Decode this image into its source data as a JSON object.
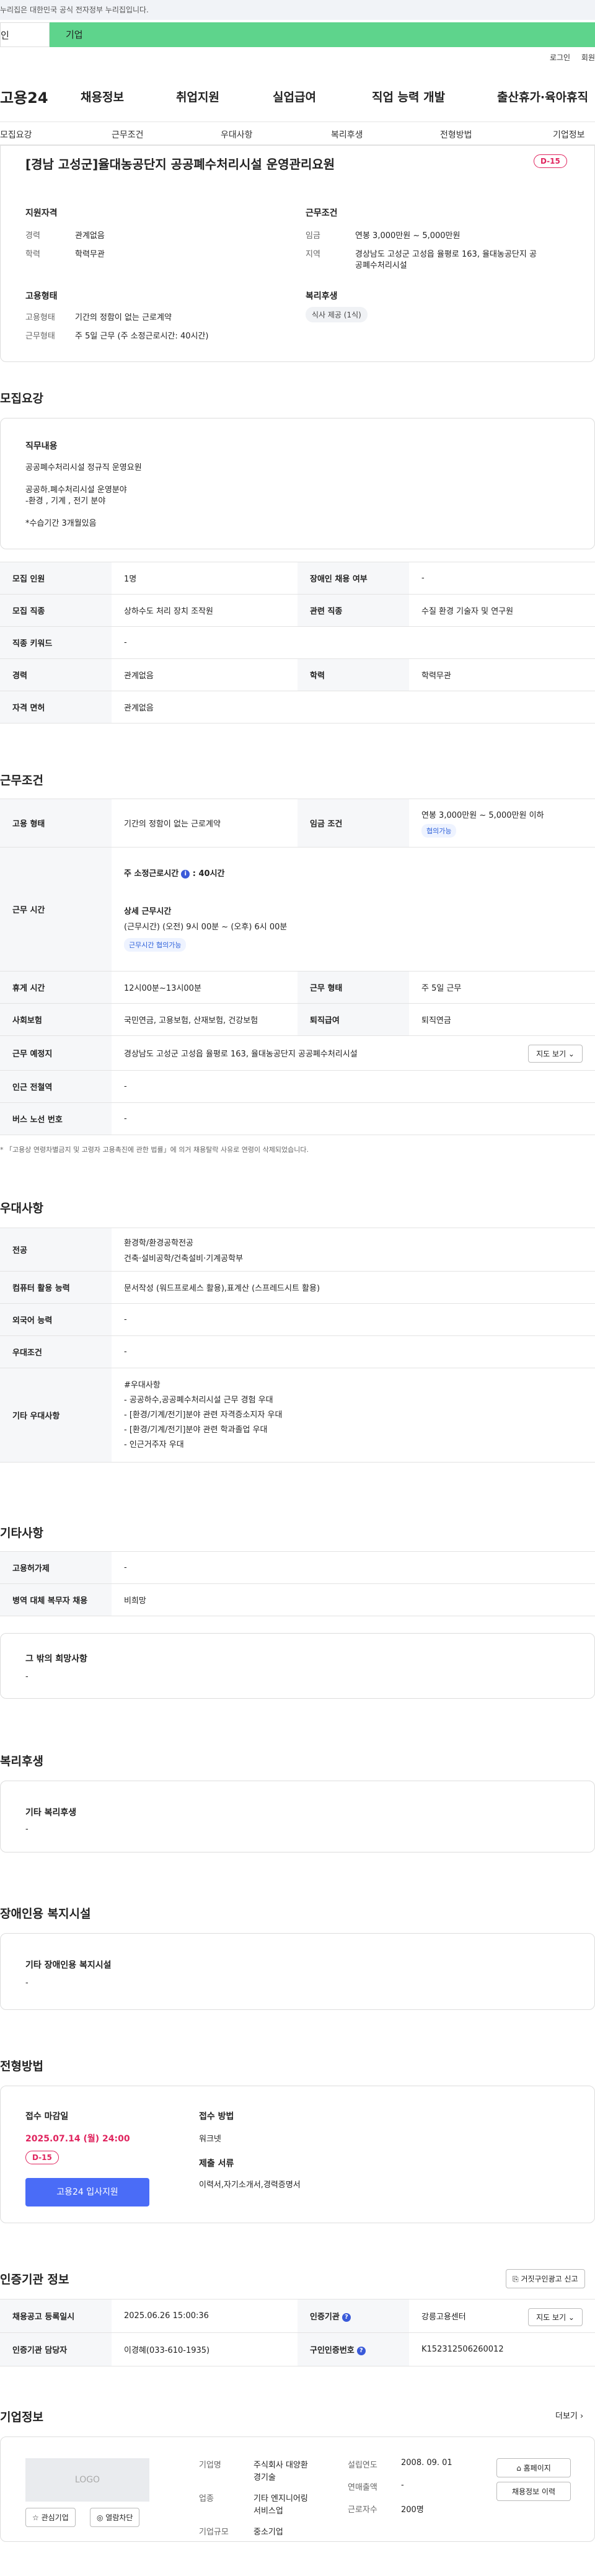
{
  "gov_banner": "누리집은 대한민국 공식 전자정부 누리집입니다.",
  "user_tabs": {
    "individual": "인",
    "company": "기업"
  },
  "util": {
    "login": "로그인",
    "join": "회원"
  },
  "gnb": {
    "logo": "고용24",
    "items": [
      "채용정보",
      "취업지원",
      "실업급여",
      "직업 능력 개발",
      "출산휴가·육아휴직"
    ]
  },
  "snb": [
    "모집요강",
    "근무조건",
    "우대사항",
    "복리후생",
    "전형방법",
    "기업정보"
  ],
  "job": {
    "title": "[경남 고성군]율대농공단지 공공폐수처리시설 운영관리요원",
    "dday": "D-15",
    "qualification": {
      "heading": "지원자격",
      "career_label": "경력",
      "career": "관계없음",
      "edu_label": "학력",
      "edu": "학력무관"
    },
    "condition": {
      "heading": "근무조건",
      "wage_label": "임금",
      "wage": "연봉 3,000만원 ~ 5,000만원",
      "region_label": "지역",
      "region_1": "경상남도 고성군 고성읍 율평로 163, 율대농공단지 공",
      "region_2": "공폐수처리시설"
    },
    "employment": {
      "heading": "고용형태",
      "type_label": "고용형태",
      "type": "기간의 정함이 없는 근로계약",
      "hours_label": "근무형태",
      "hours": "주 5일 근무 (주 소정근로시간: 40시간)"
    },
    "welfare": {
      "heading": "복리후생",
      "pill": "식사 제공 (1식)"
    }
  },
  "recruit": {
    "title": "모집요강",
    "duty_heading": "직무내용",
    "duty_lines": [
      "공공폐수처리시설 정규직 운영요원",
      "",
      "공공하.폐수처리시설 운영분야",
      "-환경 , 기계 , 전기 분야",
      "",
      "*수습기간 3개월있음"
    ],
    "table": {
      "headcount_label": "모집 인원",
      "headcount": "1명",
      "disabled_label": "장애인 채용 여부",
      "disabled": "-",
      "job_label": "모집 직종",
      "job": "상하수도 처리 장치 조작원",
      "related_label": "관련 직종",
      "related": "수질 환경 기술자 및 연구원",
      "keyword_label": "직종 키워드",
      "keyword": "-",
      "career_label": "경력",
      "career": "관계없음",
      "edu_label": "학력",
      "edu": "학력무관",
      "license_label": "자격 면허",
      "license": "관계없음"
    }
  },
  "work": {
    "title": "근무조건",
    "type_label": "고용 형태",
    "type": "기간의 정함이 없는 근로계약",
    "wage_label": "임금 조건",
    "wage": "연봉 3,000만원 ~ 5,000만원 이하",
    "wage_tag": "협의가능",
    "time_label": "근무 시간",
    "time_weekly": "주 소정근로시간",
    "time_weekly_value": ": 40시간",
    "time_detail_heading": "상세 근무시간",
    "time_detail": "(근무시간) (오전) 9시 00분 ~ (오후) 6시 00분",
    "time_tag": "근무시간 협의가능",
    "break_label": "휴게 시간",
    "break": "12시00분~13시00분",
    "shift_label": "근무 형태",
    "shift": "주 5일 근무",
    "insurance_label": "사회보험",
    "insurance": "국민연금, 고용보험, 산재보험, 건강보험",
    "severance_label": "퇴직급여",
    "severance": "퇴직연금",
    "place_label": "근무 예정지",
    "place": "경상남도 고성군 고성읍 율평로 163, 율대농공단지 공공폐수처리시설",
    "map_btn": "지도 보기 ⌄",
    "station_label": "인근 전철역",
    "station": "-",
    "bus_label": "버스 노선 번호",
    "bus": "-",
    "notice": "* 「고용상 연령차별금지 및 고령자 고용촉진에 관한 법률」에 의거 채용탈락 사유로 연령이 삭제되었습니다."
  },
  "prefer": {
    "title": "우대사항",
    "major_label": "전공",
    "major_1": "환경학/환경공학전공",
    "major_2": "건축·설비공학/건축설비·기계공학부",
    "computer_label": "컴퓨터 활용 능력",
    "computer": "문서작성 (워드프로세스 활용),표계산 (스프레드시트 활용)",
    "lang_label": "외국어 능력",
    "lang": "-",
    "cond_label": "우대조건",
    "cond": "-",
    "etc_label": "기타 우대사항",
    "etc_lines": [
      "#우대사항",
      "- 공공하수,공공폐수처리시설 근무 경험 우대",
      "- [환경/기계/전기]분야 관련 자격증소지자 우대",
      "- [환경/기계/전기]분야 관련 학과졸업 우대",
      "- 인근거주자 우대"
    ]
  },
  "others": {
    "title": "기타사항",
    "insurance_label": "고용허가제",
    "insurance": "-",
    "military_label": "병역 대체 복무자 채용",
    "military": "비희망",
    "etc_heading": "그 밖의 희망사항",
    "etc": "-"
  },
  "benefit": {
    "title": "복리후생",
    "heading": "기타 복리후생",
    "value": "-"
  },
  "disabled_facility": {
    "title": "장애인용 복지시설",
    "heading": "기타 장애인용 복지시설",
    "value": "-"
  },
  "process": {
    "title": "전형방법",
    "deadline_heading": "접수 마감일",
    "deadline": "2025.07.14 (월) 24:00",
    "dday": "D-15",
    "apply_btn": "고용24 입사지원",
    "method_heading": "접수 방법",
    "method": "워크넷",
    "docs_heading": "제출 서류",
    "docs": "이력서,자기소개서,경력증명서"
  },
  "cert": {
    "title": "인증기관 정보",
    "report_btn": "거짓구인광고 신고",
    "reg_date_label": "채용공고 등록일시",
    "reg_date": "2025.06.26 15:00:36",
    "agency_label": "인증기관",
    "agency": "강릉고용센터",
    "map_btn": "지도 보기 ⌄",
    "manager_label": "인증기관 담당자",
    "manager": "이경혜(033-610-1935)",
    "cert_no_label": "구인인증번호",
    "cert_no": "K152312506260012"
  },
  "company": {
    "title": "기업정보",
    "more": "더보기 ›",
    "logo": "LOGO",
    "fav_btn": "☆ 관심기업",
    "block_btn": "◎ 열람차단",
    "name_label": "기업명",
    "name_1": "주식회사 대양환",
    "name_2": "경기술",
    "industry_label": "업종",
    "industry_1": "기타 엔지니어링",
    "industry_2": "서비스업",
    "scale_label": "기업규모",
    "scale": "중소기업",
    "founded_label": "설립연도",
    "founded": "2008. 09. 01",
    "sales_label": "연매출액",
    "sales": "-",
    "staff_label": "근로자수",
    "staff": "200명",
    "homepage_btn": "홈페이지",
    "jobs_btn": "채용정보 이력"
  }
}
